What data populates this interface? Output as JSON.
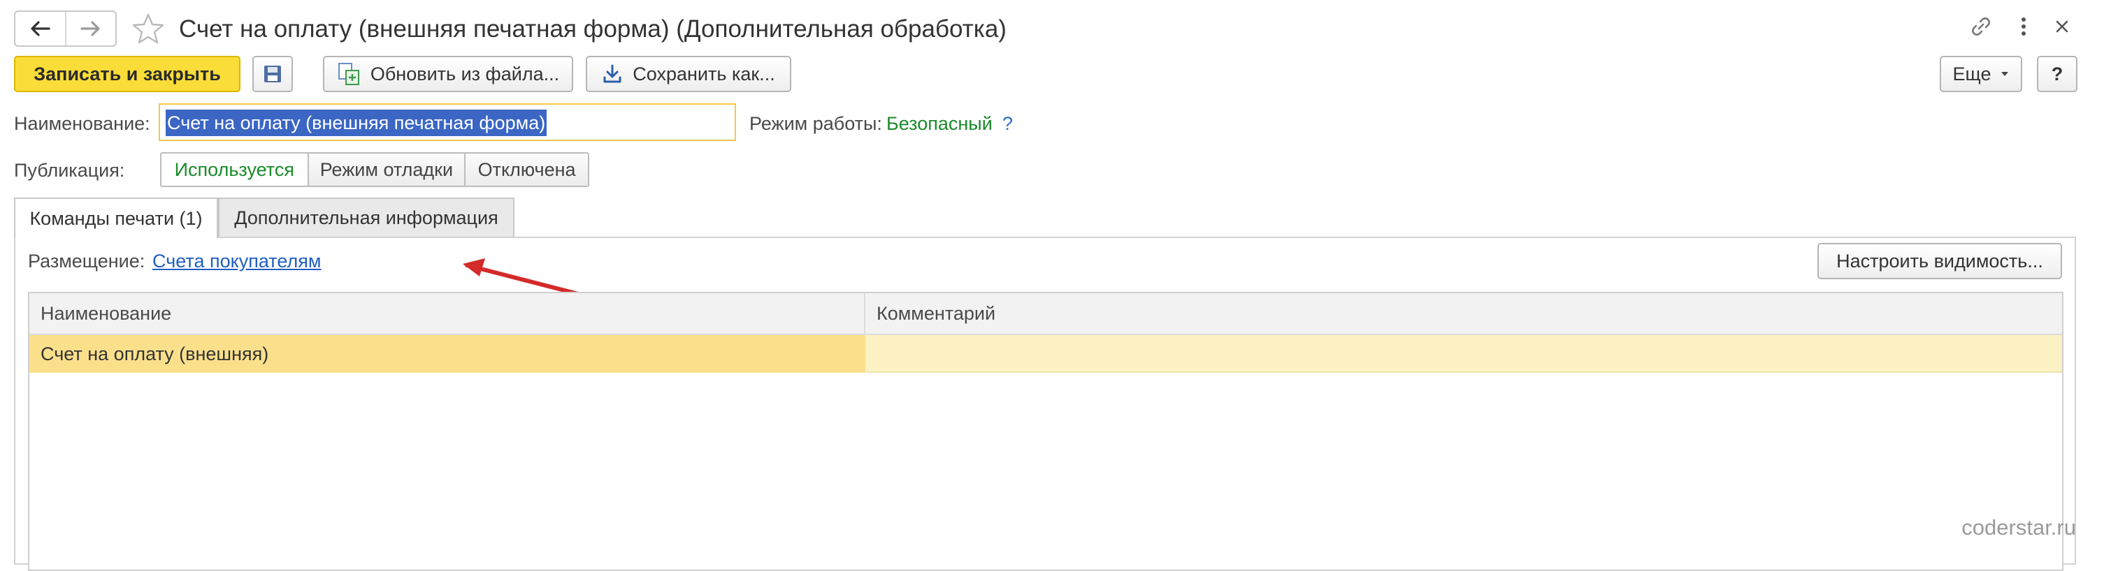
{
  "window": {
    "title": "Счет на оплату (внешняя печатная форма) (Дополнительная обработка)",
    "icons": [
      "arrow-left-icon",
      "arrow-right-icon",
      "star-icon",
      "link-icon",
      "more-vertical-icon",
      "close-icon"
    ]
  },
  "toolbar": {
    "save_close_label": "Записать и закрыть",
    "update_from_file_label": "Обновить из файла...",
    "save_as_label": "Сохранить как...",
    "more_label": "Еще",
    "help_label": "?"
  },
  "form": {
    "name_label": "Наименование:",
    "name_value": "Счет на оплату (внешняя печатная форма)",
    "mode_label": "Режим работы:",
    "mode_value": "Безопасный",
    "mode_help": "?",
    "publication_label": "Публикация:",
    "publication_options": [
      "Используется",
      "Режим отладки",
      "Отключена"
    ],
    "publication_selected": "Используется"
  },
  "tabs": [
    {
      "label": "Команды печати (1)",
      "active": true
    },
    {
      "label": "Дополнительная информация",
      "active": false
    }
  ],
  "commands": {
    "placement_label": "Размещение:",
    "placement_link": "Счета покупателям",
    "configure_visibility_label": "Настроить видимость...",
    "columns": [
      "Наименование",
      "Комментарий"
    ],
    "rows": [
      {
        "name": "Счет на оплату (внешняя)",
        "comment": ""
      }
    ]
  },
  "watermark": "coderstar.ru",
  "colors": {
    "primary_button": "#fbdd39",
    "selection": "#3b66c4",
    "active_green": "#1b8a2a",
    "link": "#1f5fc0",
    "row_highlight": "#fbe08b",
    "annotation_arrow": "#d42a2a"
  }
}
